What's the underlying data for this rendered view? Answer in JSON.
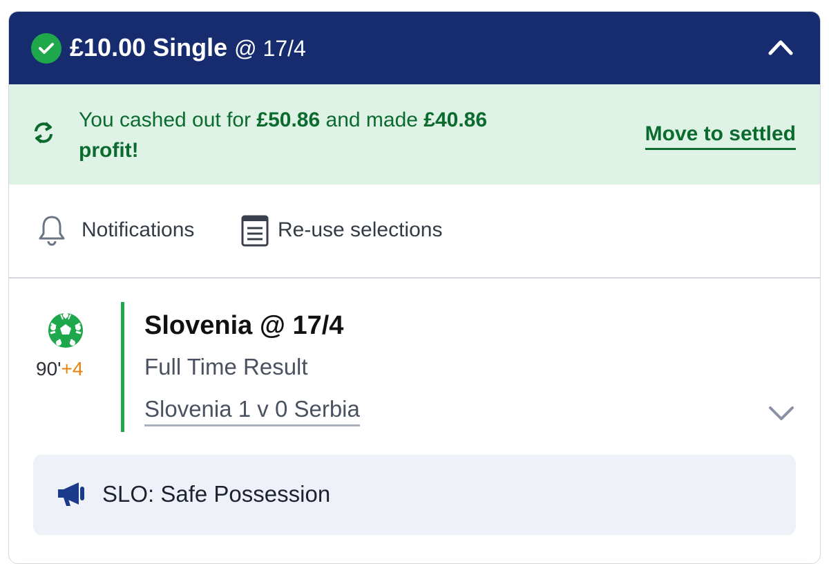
{
  "header": {
    "stake": "£10.00 Single",
    "odds": "@ 17/4"
  },
  "banner": {
    "prefix": "You cashed out for ",
    "cashout_amount": "£50.86",
    "middle": " and made ",
    "profit_amount": "£40.86",
    "suffix": "profit!",
    "move_link": "Move to settled"
  },
  "actions": {
    "notifications": "Notifications",
    "reuse": "Re-use selections"
  },
  "selection": {
    "clock": "90'",
    "added_time": "+4",
    "name": "Slovenia @ 17/4",
    "market": "Full Time Result",
    "event": "Slovenia 1 v 0 Serbia"
  },
  "info": {
    "text": "SLO: Safe Possession"
  },
  "colors": {
    "header_bg": "#162c6e",
    "banner_bg": "#dff2e6",
    "success_green": "#1ea84b",
    "profit_text": "#0b6b2e",
    "added_time": "#e8820e"
  },
  "icons": [
    "check-icon",
    "chevron-up-icon",
    "cash-out-icon",
    "bell-icon",
    "document-icon",
    "football-icon",
    "chevron-down-icon",
    "megaphone-icon"
  ]
}
